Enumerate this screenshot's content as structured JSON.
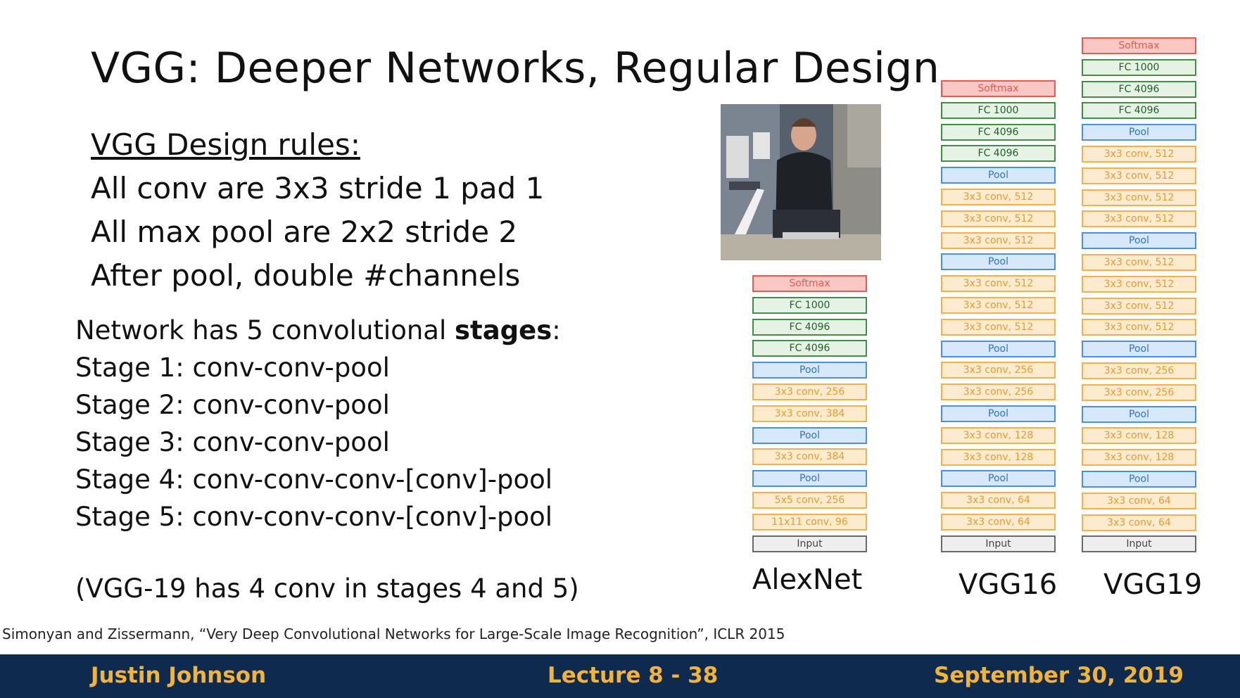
{
  "title": "VGG: Deeper Networks, Regular Design",
  "rules": {
    "heading": "VGG Design rules:",
    "items": [
      "All conv are 3x3 stride 1 pad 1",
      "All max pool are 2x2 stride 2",
      "After pool, double #channels"
    ]
  },
  "stages": {
    "intro_pre": "Network has 5 convolutional ",
    "intro_bold": "stages",
    "intro_post": ":",
    "items": [
      "Stage 1: conv-conv-pool",
      "Stage 2: conv-conv-pool",
      "Stage 3: conv-conv-pool",
      "Stage 4: conv-conv-conv-[conv]-pool",
      "Stage 5: conv-conv-conv-[conv]-pool"
    ]
  },
  "note": "(VGG-19 has 4 conv in stages 4 and 5)",
  "citation": "Simonyan and Zissermann, “Very Deep Convolutional Networks for Large-Scale Image Recognition”, ICLR 2015",
  "footer": {
    "author": "Justin Johnson",
    "lecture": "Lecture 8 - 38",
    "date": "September 30, 2019"
  },
  "colors": {
    "softmax": "#e8594e",
    "fc": "#3f8f46",
    "pool": "#4a8fe6",
    "conv": "#f6b04a",
    "input": "#6a6a6a",
    "footer_bg": "#0f2a4f",
    "footer_text": "#f2b336"
  },
  "networks": [
    {
      "name": "AlexNet",
      "layers": [
        {
          "type": "softmax",
          "label": "Softmax"
        },
        {
          "type": "fc",
          "label": "FC 1000"
        },
        {
          "type": "fc",
          "label": "FC 4096"
        },
        {
          "type": "fc",
          "label": "FC 4096"
        },
        {
          "type": "pool",
          "label": "Pool"
        },
        {
          "type": "conv",
          "label": "3x3 conv, 256"
        },
        {
          "type": "conv",
          "label": "3x3 conv, 384"
        },
        {
          "type": "pool",
          "label": "Pool"
        },
        {
          "type": "conv",
          "label": "3x3 conv, 384"
        },
        {
          "type": "pool",
          "label": "Pool"
        },
        {
          "type": "conv",
          "label": "5x5 conv, 256"
        },
        {
          "type": "conv",
          "label": "11x11 conv, 96"
        },
        {
          "type": "input",
          "label": "Input"
        }
      ]
    },
    {
      "name": "VGG16",
      "layers": [
        {
          "type": "softmax",
          "label": "Softmax"
        },
        {
          "type": "fc",
          "label": "FC 1000"
        },
        {
          "type": "fc",
          "label": "FC 4096"
        },
        {
          "type": "fc",
          "label": "FC 4096"
        },
        {
          "type": "pool",
          "label": "Pool"
        },
        {
          "type": "conv",
          "label": "3x3 conv, 512"
        },
        {
          "type": "conv",
          "label": "3x3 conv, 512"
        },
        {
          "type": "conv",
          "label": "3x3 conv, 512"
        },
        {
          "type": "pool",
          "label": "Pool"
        },
        {
          "type": "conv",
          "label": "3x3 conv, 512"
        },
        {
          "type": "conv",
          "label": "3x3 conv, 512"
        },
        {
          "type": "conv",
          "label": "3x3 conv, 512"
        },
        {
          "type": "pool",
          "label": "Pool"
        },
        {
          "type": "conv",
          "label": "3x3 conv, 256"
        },
        {
          "type": "conv",
          "label": "3x3 conv, 256"
        },
        {
          "type": "pool",
          "label": "Pool"
        },
        {
          "type": "conv",
          "label": "3x3 conv, 128"
        },
        {
          "type": "conv",
          "label": "3x3 conv, 128"
        },
        {
          "type": "pool",
          "label": "Pool"
        },
        {
          "type": "conv",
          "label": "3x3 conv, 64"
        },
        {
          "type": "conv",
          "label": "3x3 conv, 64"
        },
        {
          "type": "input",
          "label": "Input"
        }
      ]
    },
    {
      "name": "VGG19",
      "layers": [
        {
          "type": "softmax",
          "label": "Softmax"
        },
        {
          "type": "fc",
          "label": "FC 1000"
        },
        {
          "type": "fc",
          "label": "FC 4096"
        },
        {
          "type": "fc",
          "label": "FC 4096"
        },
        {
          "type": "pool",
          "label": "Pool"
        },
        {
          "type": "conv",
          "label": "3x3 conv, 512"
        },
        {
          "type": "conv",
          "label": "3x3 conv, 512"
        },
        {
          "type": "conv",
          "label": "3x3 conv, 512"
        },
        {
          "type": "conv",
          "label": "3x3 conv, 512"
        },
        {
          "type": "pool",
          "label": "Pool"
        },
        {
          "type": "conv",
          "label": "3x3 conv, 512"
        },
        {
          "type": "conv",
          "label": "3x3 conv, 512"
        },
        {
          "type": "conv",
          "label": "3x3 conv, 512"
        },
        {
          "type": "conv",
          "label": "3x3 conv, 512"
        },
        {
          "type": "pool",
          "label": "Pool"
        },
        {
          "type": "conv",
          "label": "3x3 conv, 256"
        },
        {
          "type": "conv",
          "label": "3x3 conv, 256"
        },
        {
          "type": "pool",
          "label": "Pool"
        },
        {
          "type": "conv",
          "label": "3x3 conv, 128"
        },
        {
          "type": "conv",
          "label": "3x3 conv, 128"
        },
        {
          "type": "pool",
          "label": "Pool"
        },
        {
          "type": "conv",
          "label": "3x3 conv, 64"
        },
        {
          "type": "conv",
          "label": "3x3 conv, 64"
        },
        {
          "type": "input",
          "label": "Input"
        }
      ]
    }
  ]
}
